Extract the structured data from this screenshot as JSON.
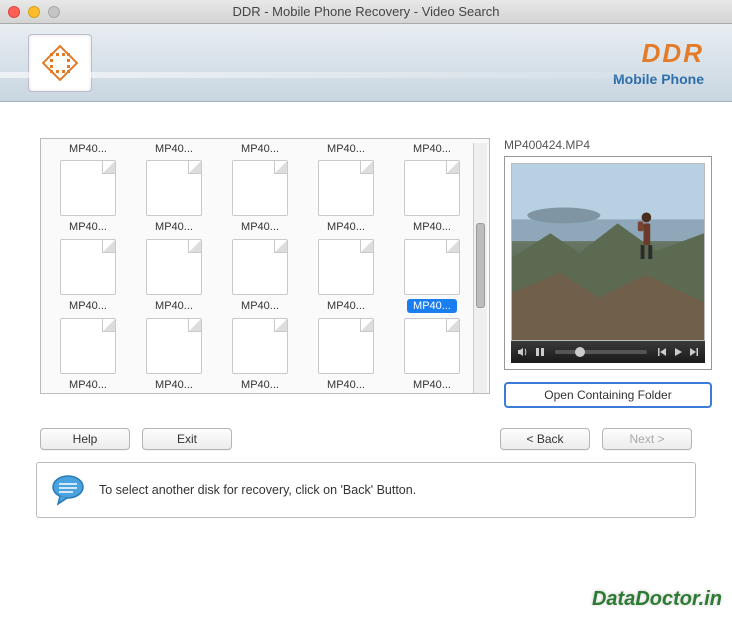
{
  "window": {
    "title": "DDR - Mobile Phone Recovery - Video Search"
  },
  "brand": {
    "name": "DDR",
    "subtitle": "Mobile Phone"
  },
  "files": {
    "row1": [
      "MP40...",
      "MP40...",
      "MP40...",
      "MP40...",
      "MP40..."
    ],
    "row2": [
      "MP40...",
      "MP40...",
      "MP40...",
      "MP40...",
      "MP40..."
    ],
    "row3": [
      "MP40...",
      "MP40...",
      "MP40...",
      "MP40...",
      "MP40..."
    ],
    "selected_index": 9
  },
  "preview": {
    "filename": "MP400424.MP4",
    "open_folder_label": "Open Containing Folder"
  },
  "buttons": {
    "help": "Help",
    "exit": "Exit",
    "back": "< Back",
    "next": "Next >"
  },
  "info": {
    "message": "To select another disk for recovery, click on 'Back' Button."
  },
  "watermark": "DataDoctor.in"
}
